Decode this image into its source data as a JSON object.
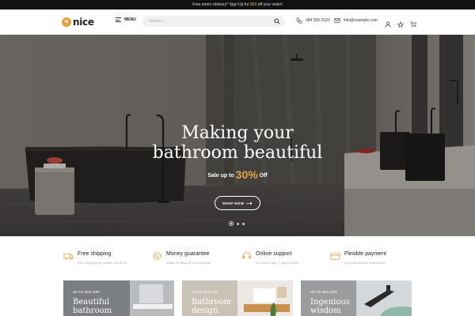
{
  "topbar": {
    "text_before": "Free metro delivery* Sign Up for ",
    "highlight": "$50",
    "text_after": " off your order!"
  },
  "header": {
    "logo_mark": "N",
    "logo_text": "nice",
    "menu_label": "MENU",
    "search_placeholder": "Search...",
    "phone": "084 555-0120",
    "email": "info@example.com"
  },
  "hero": {
    "title_line1": "Making your",
    "title_line2": "bathroom beautiful",
    "sale_prefix": "Sale up to ",
    "sale_percent": "30%",
    "sale_suffix": " Off",
    "cta_label": "SHOP NOW"
  },
  "features": [
    {
      "icon": "truck-icon",
      "title": "Free shipping",
      "subtitle": "Free Shipping for orders over $130"
    },
    {
      "icon": "money-icon",
      "title": "Money guarantee",
      "subtitle": "Within 30 days for an exchange."
    },
    {
      "icon": "support-icon",
      "title": "Online support",
      "subtitle": "24 hours a day, 7 days a week"
    },
    {
      "icon": "credit-card-icon",
      "title": "Flexible payment",
      "subtitle": "Pay with multiple credit cards"
    }
  ],
  "cards": [
    {
      "tag": "UP TO 30% OFF",
      "title": "Beautiful bathroom"
    },
    {
      "tag": "UP TO 20% OFF",
      "title": "Bathroom design"
    },
    {
      "tag": "UP TO 50% OFF",
      "title": "Ingenious wisdom"
    }
  ],
  "colors": {
    "accent": "#e8a33c",
    "topbar_bg": "#111111"
  }
}
